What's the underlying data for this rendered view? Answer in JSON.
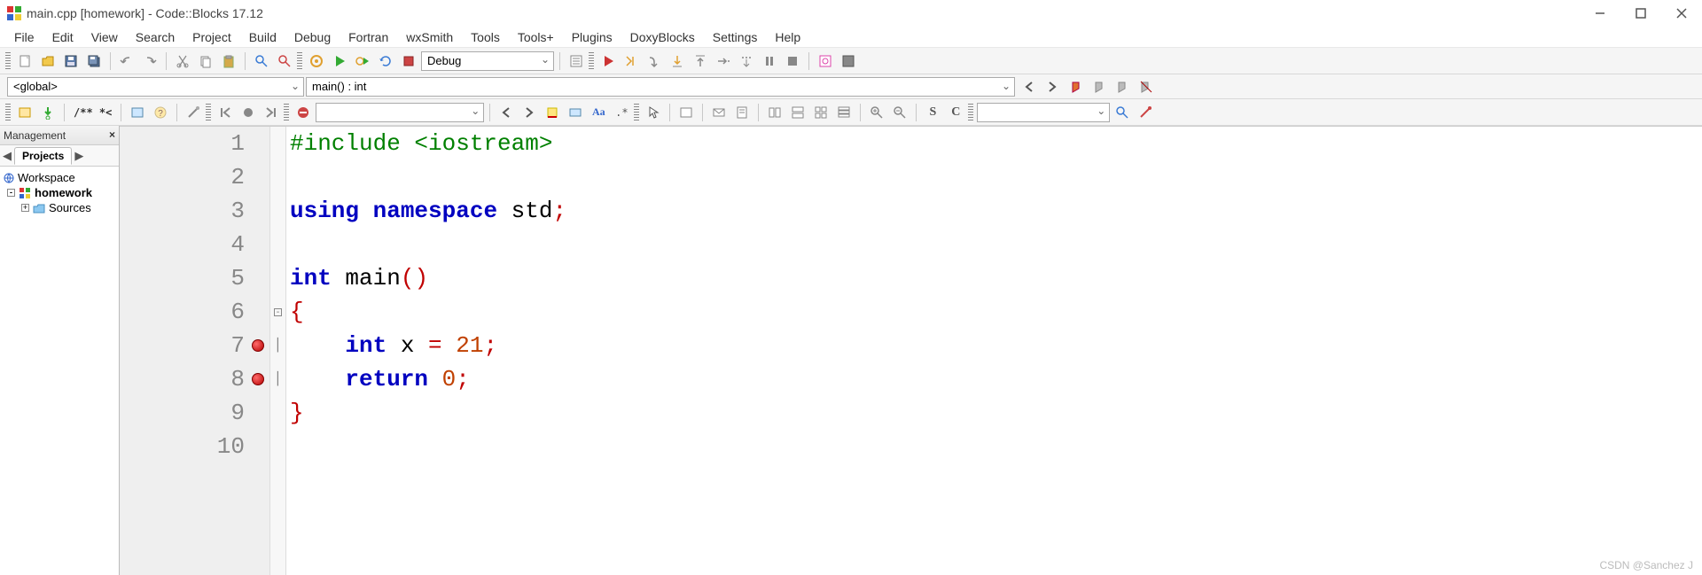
{
  "window": {
    "title": "main.cpp [homework] - Code::Blocks 17.12"
  },
  "menu": [
    "File",
    "Edit",
    "View",
    "Search",
    "Project",
    "Build",
    "Debug",
    "Fortran",
    "wxSmith",
    "Tools",
    "Tools+",
    "Plugins",
    "DoxyBlocks",
    "Settings",
    "Help"
  ],
  "toolbar1": {
    "build_target": "Debug"
  },
  "scope": {
    "scope_value": "<global>",
    "function_value": "main() : int"
  },
  "toolbar3": {
    "comment_token": "/** *<",
    "letter_s": "S",
    "letter_c": "C"
  },
  "management": {
    "title": "Management",
    "tab_active": "Projects",
    "tree": {
      "workspace": "Workspace",
      "project": "homework",
      "sources": "Sources"
    }
  },
  "editor": {
    "lines": [
      {
        "n": 1,
        "bp": false,
        "fold": "",
        "tokens": [
          [
            "pp",
            "#include <iostream>"
          ]
        ]
      },
      {
        "n": 2,
        "bp": false,
        "fold": "",
        "tokens": []
      },
      {
        "n": 3,
        "bp": false,
        "fold": "",
        "tokens": [
          [
            "kw",
            "using"
          ],
          [
            "",
            " "
          ],
          [
            "kw",
            "namespace"
          ],
          [
            "",
            " "
          ],
          [
            "",
            "std"
          ],
          [
            "op",
            ";"
          ]
        ]
      },
      {
        "n": 4,
        "bp": false,
        "fold": "",
        "tokens": []
      },
      {
        "n": 5,
        "bp": false,
        "fold": "",
        "tokens": [
          [
            "kw",
            "int"
          ],
          [
            "",
            " "
          ],
          [
            "",
            "main"
          ],
          [
            "op",
            "()"
          ]
        ]
      },
      {
        "n": 6,
        "bp": false,
        "fold": "⊟",
        "tokens": [
          [
            "brace",
            "{"
          ]
        ]
      },
      {
        "n": 7,
        "bp": true,
        "fold": "│",
        "tokens": [
          [
            "",
            "    "
          ],
          [
            "kw",
            "int"
          ],
          [
            "",
            " x "
          ],
          [
            "op",
            "="
          ],
          [
            "",
            " "
          ],
          [
            "num",
            "21"
          ],
          [
            "op",
            ";"
          ]
        ]
      },
      {
        "n": 8,
        "bp": true,
        "fold": "│",
        "tokens": [
          [
            "",
            "    "
          ],
          [
            "kw",
            "return"
          ],
          [
            "",
            " "
          ],
          [
            "num",
            "0"
          ],
          [
            "op",
            ";"
          ]
        ]
      },
      {
        "n": 9,
        "bp": false,
        "fold": "",
        "tokens": [
          [
            "brace",
            "}"
          ]
        ]
      },
      {
        "n": 10,
        "bp": false,
        "fold": "",
        "tokens": []
      }
    ]
  },
  "watermark": "CSDN @Sanchez J"
}
